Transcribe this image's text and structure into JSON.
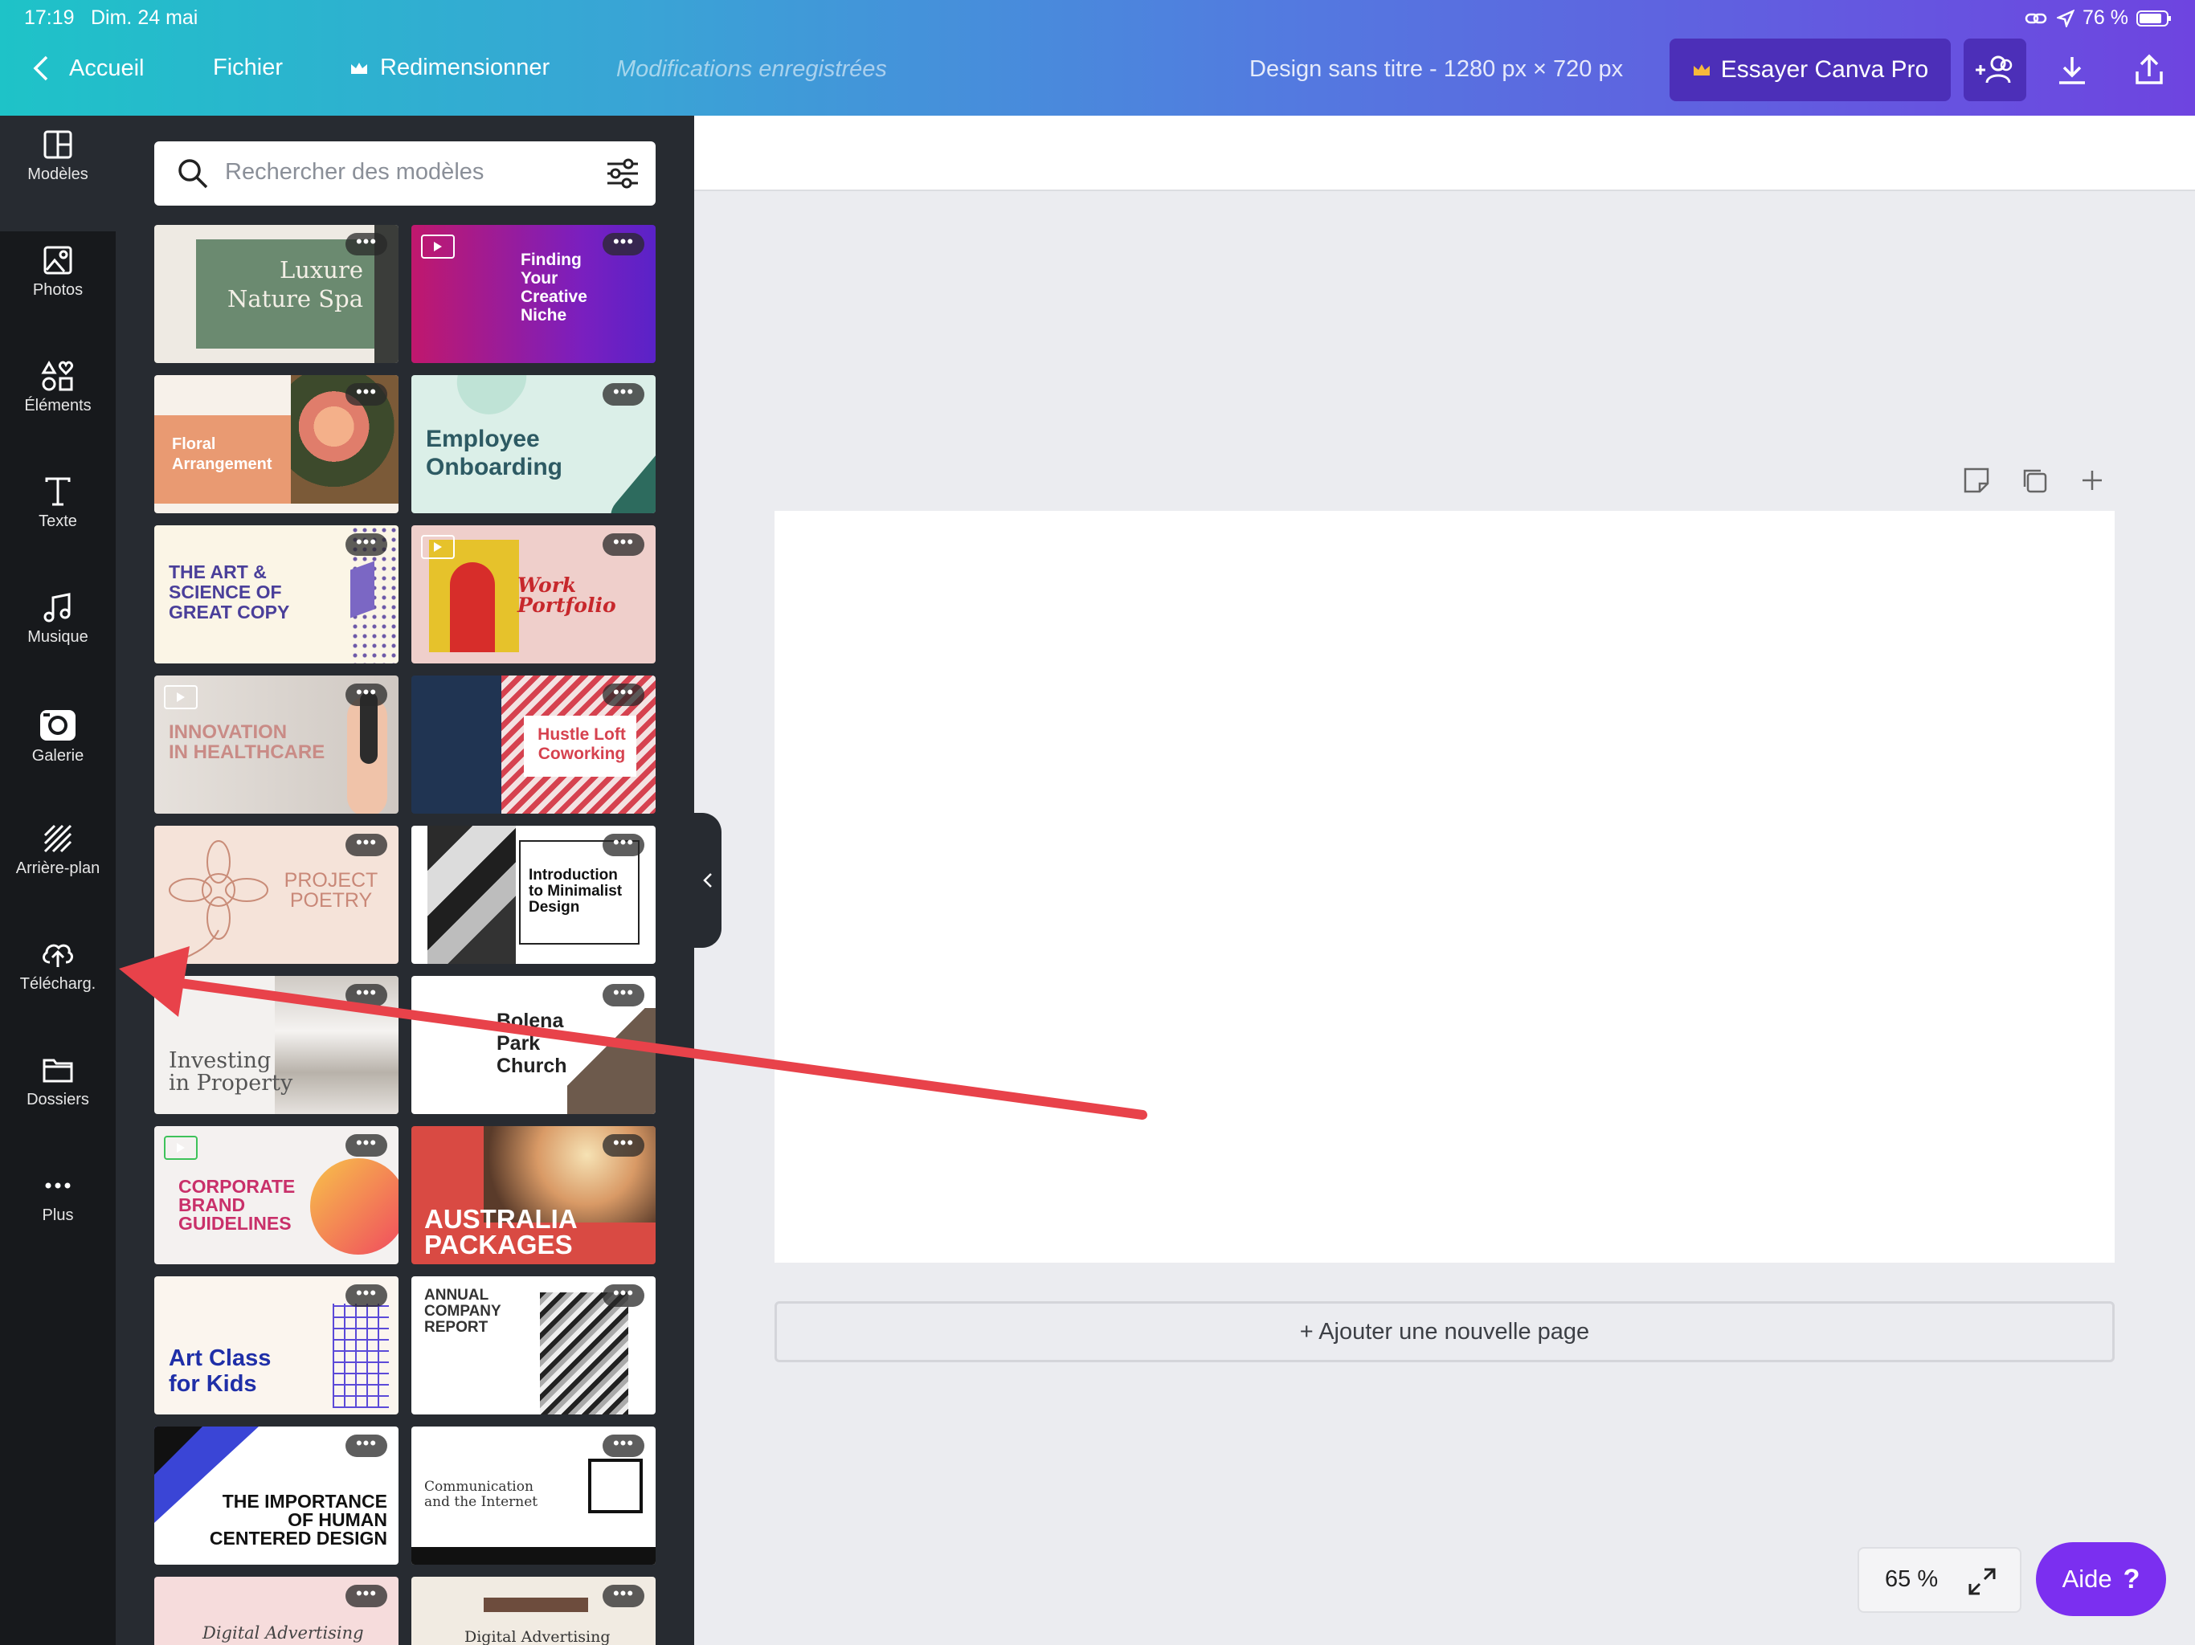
{
  "status_bar": {
    "time": "17:19",
    "date": "Dim. 24 mai",
    "battery": "76 %"
  },
  "toolbar": {
    "back_label": "Accueil",
    "file_label": "Fichier",
    "resize_label": "Redimensionner",
    "saved_status": "Modifications enregistrées",
    "design_title": "Design sans titre - 1280 px × 720 px",
    "pro_label": "Essayer Canva Pro"
  },
  "sidebar": {
    "items": [
      {
        "label": "Modèles",
        "icon": "templates-icon"
      },
      {
        "label": "Photos",
        "icon": "photos-icon"
      },
      {
        "label": "Éléments",
        "icon": "elements-icon"
      },
      {
        "label": "Texte",
        "icon": "text-icon"
      },
      {
        "label": "Musique",
        "icon": "music-icon"
      },
      {
        "label": "Galerie",
        "icon": "camera-icon"
      },
      {
        "label": "Arrière-plan",
        "icon": "background-icon"
      },
      {
        "label": "Télécharg.",
        "icon": "upload-cloud-icon"
      },
      {
        "label": "Dossiers",
        "icon": "folder-icon"
      },
      {
        "label": "Plus",
        "icon": "more-icon"
      }
    ]
  },
  "search": {
    "placeholder": "Rechercher des modèles"
  },
  "templates": [
    {
      "title": "Luxure\nNature Spa"
    },
    {
      "title": "Finding\nYour\nCreative\nNiche"
    },
    {
      "title": "Floral\nArrangement"
    },
    {
      "title": "Employee\nOnboarding"
    },
    {
      "title": "THE ART &\nSCIENCE OF\nGREAT COPY"
    },
    {
      "title": "Work\nPortfolio"
    },
    {
      "title": "INNOVATION\nIN HEALTHCARE"
    },
    {
      "title": "Hustle Loft\nCoworking"
    },
    {
      "title": "PROJECT\nPOETRY"
    },
    {
      "title": "Introduction\nto Minimalist\nDesign"
    },
    {
      "title": "Investing\nin Property"
    },
    {
      "title": "Bolena\nPark\nChurch"
    },
    {
      "title": "CORPORATE\nBRAND\nGUIDELINES"
    },
    {
      "title": "AUSTRALIA\nPACKAGES"
    },
    {
      "title": "Art Class\nfor Kids"
    },
    {
      "title": "ANNUAL\nCOMPANY\nREPORT"
    },
    {
      "title": "THE IMPORTANCE\nOF HUMAN\nCENTERED DESIGN"
    },
    {
      "title": "Communication\nand the Internet"
    },
    {
      "title": "Digital Advertising"
    },
    {
      "title": "Digital Advertising"
    }
  ],
  "canvas": {
    "add_page_label": "+ Ajouter une nouvelle page"
  },
  "footer": {
    "zoom": "65 %",
    "help_label": "Aide",
    "help_icon": "?"
  },
  "colors": {
    "accent": "#7b2ff0",
    "sidebar": "#17191c",
    "panel": "#272b31",
    "arrow": "#e8424a"
  }
}
